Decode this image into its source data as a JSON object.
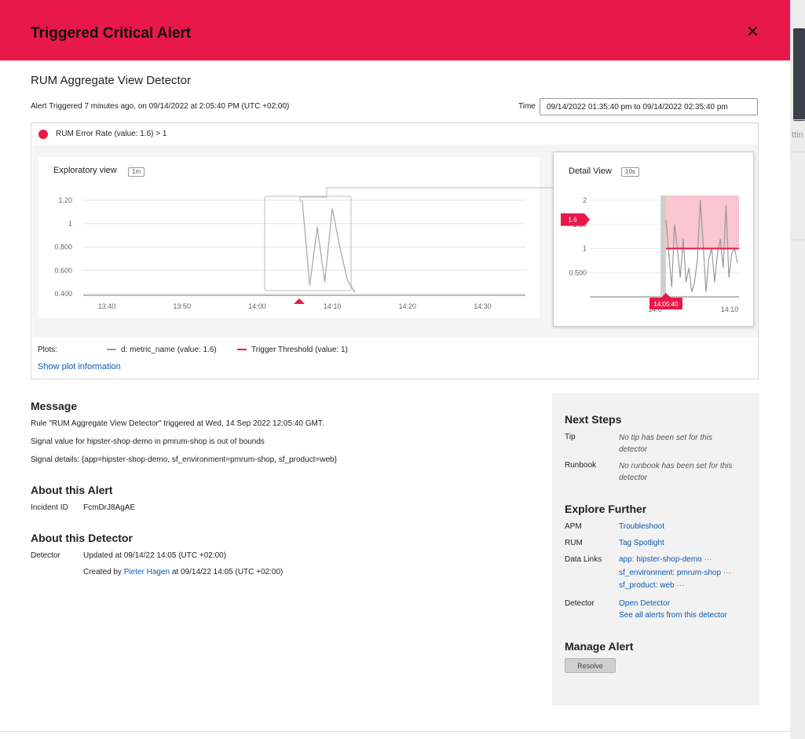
{
  "modal": {
    "title": "Triggered Critical Alert",
    "detector_name": "RUM Aggregate View Detector",
    "triggered_text": "Alert Triggered 7 minutes ago, on 09/14/2022 at 2:05:40 PM (UTC +02:00)",
    "time_label": "Time",
    "time_range": "09/14/2022 01:35:40 pm to 09/14/2022 02:35:40 pm",
    "close_icon": "close-icon"
  },
  "signal": {
    "label": "RUM Error Rate (value: 1.6) > 1",
    "color": "#e8184a"
  },
  "exploratory": {
    "title": "Exploratory view",
    "resolution": "1m",
    "y_ticks": [
      "1.20",
      "1",
      "0.800",
      "0.600",
      "0.400"
    ],
    "x_ticks": [
      "13:40",
      "13:50",
      "14:00",
      "14:10",
      "14:20",
      "14:30"
    ]
  },
  "detail": {
    "title": "Detail View",
    "resolution": "10s",
    "y_ticks": [
      "2",
      "1.50",
      "1",
      "0.500"
    ],
    "x_ticks": [
      "14:0",
      "14:10"
    ],
    "value_flag": "1.6",
    "time_flag": "14:05:40",
    "alert_fill": "#f9c6d1"
  },
  "legend": {
    "plots_label": "Plots:",
    "series1": "d:  metric_name  (value: 1.6)",
    "series1_color": "#999999",
    "series2": "Trigger Threshold  (value: 1)",
    "series2_color": "#e8184a",
    "show_plot_info": "Show plot information"
  },
  "chart_data": [
    {
      "type": "line",
      "title": "Exploratory view",
      "xlabel": "",
      "ylabel": "",
      "ylim": [
        0.4,
        1.3
      ],
      "x_ticks": [
        "13:40",
        "13:50",
        "14:00",
        "14:10",
        "14:20",
        "14:30"
      ],
      "series": [
        {
          "x": [
            "14:06",
            "14:07",
            "14:08",
            "14:09",
            "14:10",
            "14:11",
            "14:12",
            "14:13"
          ],
          "values": [
            1.2,
            0.47,
            0.97,
            0.5,
            1.13,
            0.8,
            0.52,
            0.41
          ]
        }
      ]
    },
    {
      "type": "line",
      "title": "Detail View",
      "xlabel": "",
      "ylabel": "",
      "ylim": [
        0,
        2.2
      ],
      "x_ticks": [
        "14:0",
        "14:10"
      ],
      "series": [
        {
          "values": [
            1.6,
            0.9,
            0.2,
            1.5,
            1.0,
            0.4,
            1.2,
            0.3,
            0.6,
            0.1,
            0.3,
            0.8,
            2.0,
            1.1,
            0.1,
            0.8,
            1.0,
            0.3,
            0.9,
            1.2,
            0.6,
            1.9,
            0.4,
            0.9,
            1.0,
            0.7
          ]
        },
        {
          "name": "Trigger Threshold",
          "values": [
            1,
            1
          ]
        }
      ]
    }
  ],
  "message": {
    "heading": "Message",
    "line1": "Rule \"RUM Aggregate View Detector\" triggered at Wed, 14 Sep 2022 12:05:40 GMT.",
    "line2": "Signal value for hipster-shop-demo in pmrum-shop is out of bounds",
    "line3": "Signal details: {app=hipster-shop-demo, sf_environment=pmrum-shop, sf_product=web}"
  },
  "about_alert": {
    "heading": "About this Alert",
    "incident_label": "Incident ID",
    "incident_id": "FcmDrJ8AgAE"
  },
  "about_detector": {
    "heading": "About this Detector",
    "label": "Detector",
    "updated": "Updated at 09/14/22 14:05 (UTC +02:00)",
    "created_prefix": "Created by",
    "created_by": "Pieter Hagen",
    "created_suffix": "at 09/14/22 14:05 (UTC +02:00)"
  },
  "next_steps": {
    "heading": "Next Steps",
    "tip_label": "Tip",
    "tip_value": "No tip has been set for this detector",
    "runbook_label": "Runbook",
    "runbook_value": "No runbook has been set for this detector"
  },
  "explore": {
    "heading": "Explore Further",
    "apm_label": "APM",
    "apm_link": "Troubleshoot",
    "rum_label": "RUM",
    "rum_link": "Tag Spotlight",
    "data_links_label": "Data Links",
    "data_links": [
      "app: hipster-shop-demo",
      "sf_environment: pmrum-shop",
      "sf_product: web"
    ],
    "more": "···",
    "detector_label": "Detector",
    "open_detector": "Open Detector",
    "see_all": "See all alerts from this detector"
  },
  "manage": {
    "heading": "Manage Alert",
    "resolve": "Resolve"
  },
  "background": {
    "partial_text": "ttin"
  }
}
